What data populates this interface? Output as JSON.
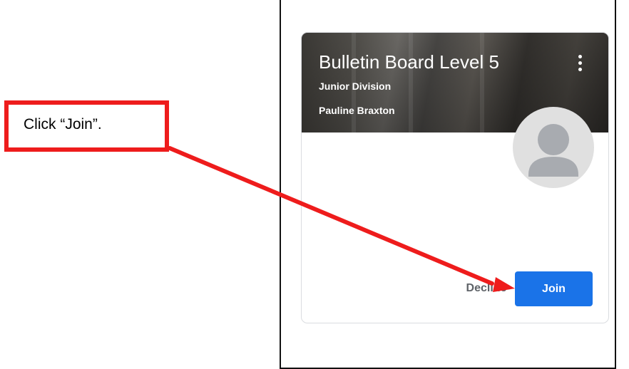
{
  "callout": {
    "text": "Click “Join”."
  },
  "class_card": {
    "title": "Bulletin Board Level 5",
    "section": "Junior Division",
    "teacher": "Pauline Braxton",
    "menu_icon": "more-vert-icon",
    "avatar_icon": "person-icon",
    "decline_label": "Decline",
    "join_label": "Join"
  },
  "colors": {
    "callout_border": "#ee1c1c",
    "arrow": "#ee1c1c",
    "join_button": "#1a73e8",
    "decline_text": "#5f6368"
  }
}
